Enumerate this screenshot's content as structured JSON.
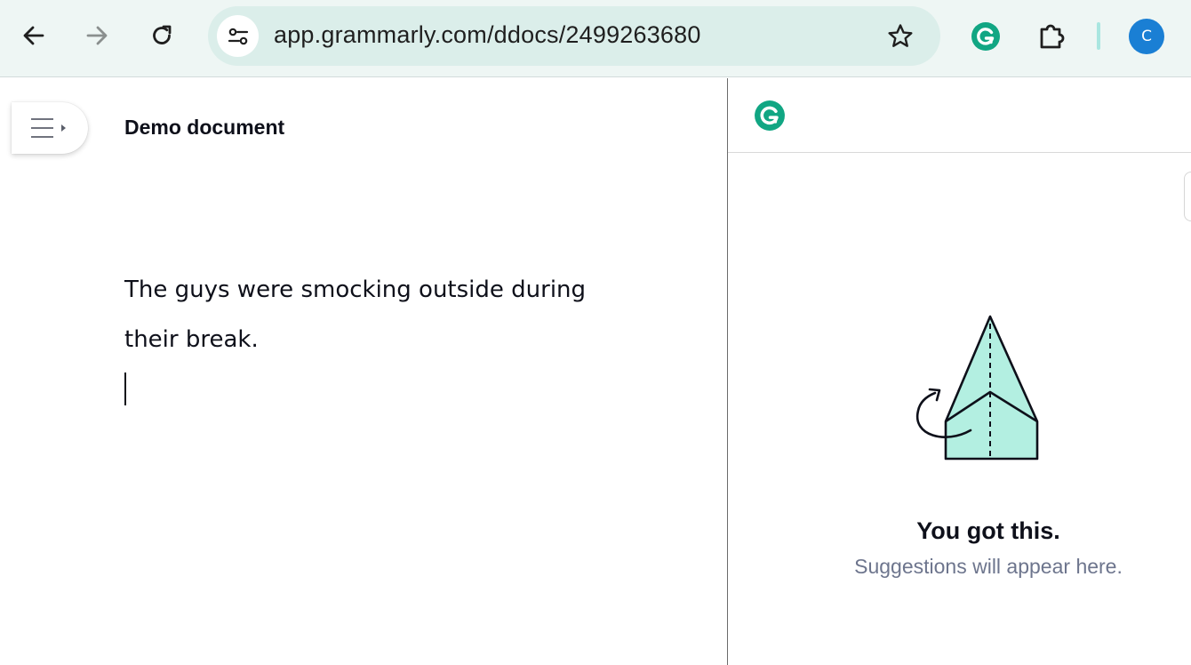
{
  "browser": {
    "url": "app.grammarly.com/ddocs/2499263680",
    "profile_initial": "C",
    "icons": {
      "back": "arrow-left-icon",
      "forward": "arrow-right-icon",
      "reload": "reload-icon",
      "site_info": "tune-icon",
      "bookmark": "star-outline-icon",
      "grammarly_extension": "grammarly-g-icon",
      "extensions": "puzzle-piece-icon"
    },
    "colors": {
      "toolbar_bg": "#eef6f4",
      "omnibox_bg": "#dbeeea",
      "avatar_bg": "#1a7fd4"
    }
  },
  "editor": {
    "title": "Demo document",
    "body_lines": [
      "The guys were smocking outside during",
      "their break."
    ],
    "menu_icon": "hamburger-menu-icon"
  },
  "assistant": {
    "logo_icon": "grammarly-g-icon",
    "empty_title": "You got this.",
    "empty_subtitle": "Suggestions will appear here.",
    "illustration_icon": "paper-plane-illustration",
    "colors": {
      "brand": "#15c39a",
      "illustration_fill": "#b3efe1"
    }
  }
}
